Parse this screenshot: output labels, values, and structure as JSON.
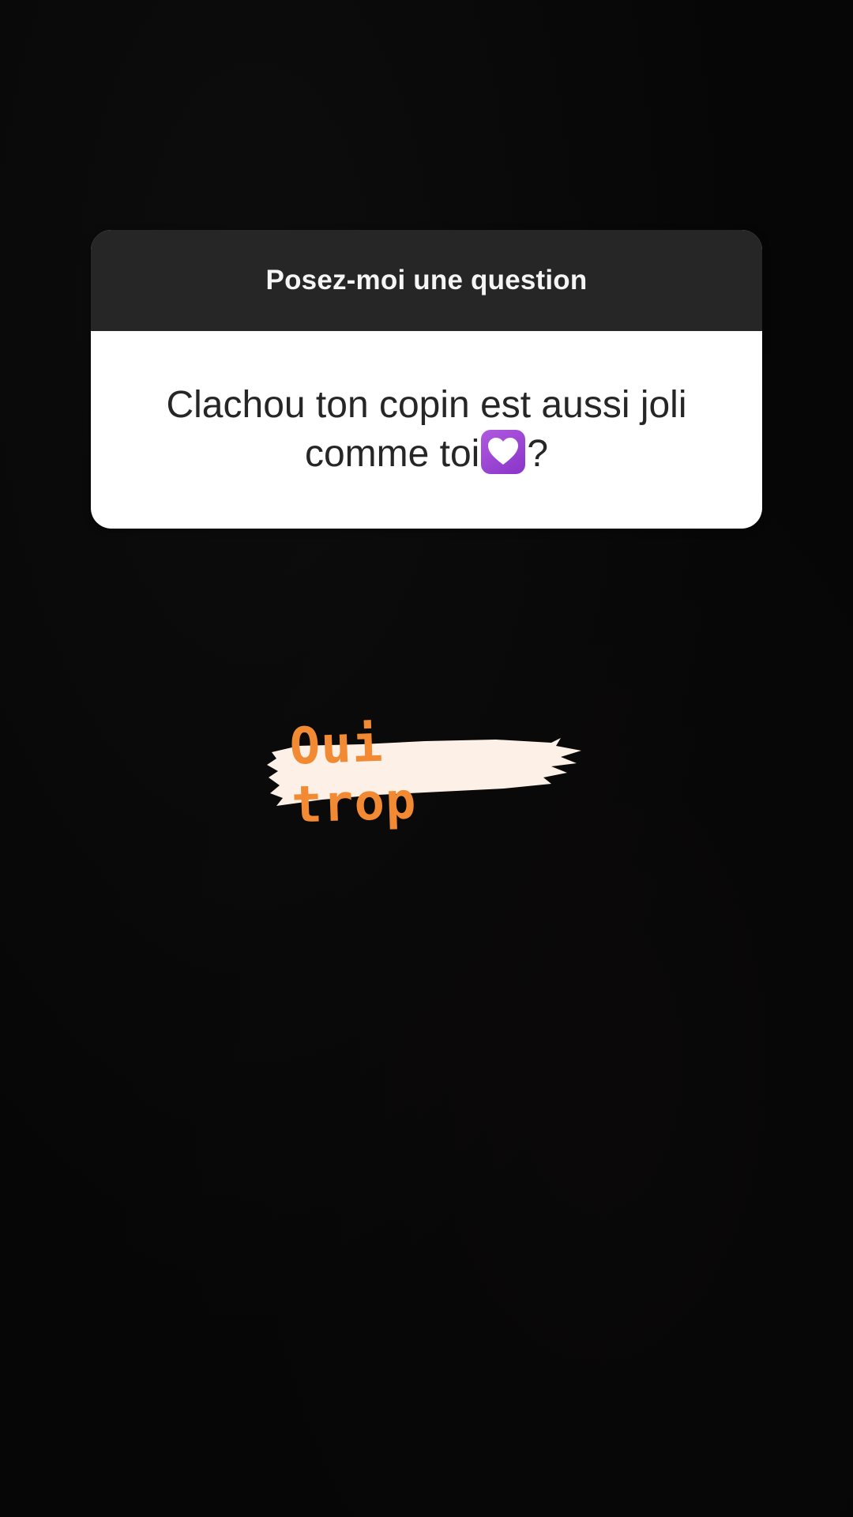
{
  "question_sticker": {
    "header": "Posez-moi une question",
    "question_text": "Clachou ton copin est aussi joli comme toi",
    "question_end": "?",
    "emoji": "heart-emoji-purple"
  },
  "answer": {
    "text": "Oui trop",
    "text_color": "#f18a33",
    "highlight_color": "#fdf1e7"
  },
  "colors": {
    "background": "#060606",
    "card_header": "#262626",
    "card_body": "#ffffff"
  }
}
